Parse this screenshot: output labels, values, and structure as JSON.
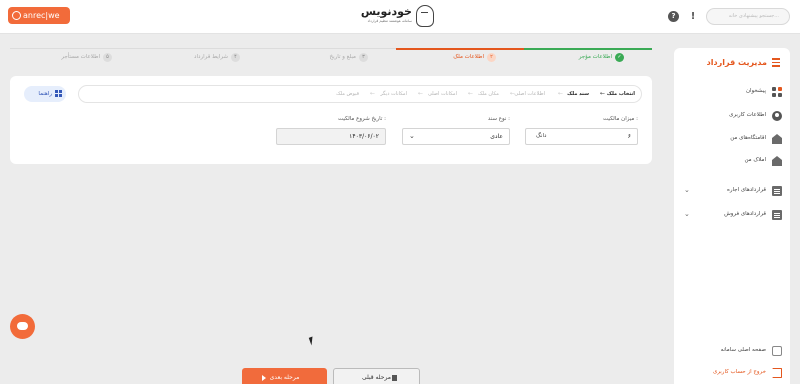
{
  "recorder": {
    "label": "anrec|we"
  },
  "header": {
    "brand": "خودنویس",
    "tagline": "سامانه هوشمند تنظیم قرارداد",
    "help_icon": "question-circle-icon",
    "alert_icon": "exclamation-icon",
    "search_placeholder": "جستجو پیشنهادی خانه..."
  },
  "sidebar": {
    "title": "مدیریت قرارداد",
    "items": [
      {
        "label": "پیشخوان",
        "icon": "dashboard-grid-icon"
      },
      {
        "label": "اطلاعات کاربری",
        "icon": "user-icon"
      },
      {
        "label": "اقامتگاه‌های من",
        "icon": "building-icon"
      },
      {
        "label": "املاک من",
        "icon": "house-icon"
      },
      {
        "label": "قراردادهای اجاره",
        "icon": "clipboard-icon"
      },
      {
        "label": "قراردادهای فروش",
        "icon": "clipboard-icon"
      }
    ],
    "footer": [
      {
        "label": "صفحه اصلی سامانه",
        "icon": "home-outline-icon"
      },
      {
        "label": "خروج از حساب کاربری",
        "icon": "logout-icon"
      }
    ]
  },
  "steps": [
    {
      "num": "✓",
      "label": "اطلاعات مؤجر",
      "state": "done"
    },
    {
      "num": "۲",
      "label": "اطلاعات ملک",
      "state": "active"
    },
    {
      "num": "۳",
      "label": "مبلغ و تاریخ",
      "state": "pending"
    },
    {
      "num": "۴",
      "label": "شرایط قرارداد",
      "state": "pending"
    },
    {
      "num": "۵",
      "label": "اطلاعات مستأجر",
      "state": "pending"
    }
  ],
  "panel": {
    "guide_label": "راهنما",
    "crumbs": [
      "انتخاب ملک",
      "سند ملک",
      "اطلاعات اصلی",
      "مکان ملک",
      "امکانات اصلی",
      "امکانات دیگر",
      "قبوض ملک"
    ],
    "fields": {
      "ownership_share": {
        "label": "میزان مالکیت :",
        "value": "۶",
        "unit": "دانگ"
      },
      "deed_type": {
        "label": "نوع سند :",
        "value": "عادی"
      },
      "ownership_date": {
        "label": "تاریخ شروع مالکیت :",
        "value": "۱۴۰۳/۰۶/۰۲"
      }
    }
  },
  "footer_buttons": {
    "next": "مرحله بعدی",
    "prev": "مرحله قبلی"
  },
  "colors": {
    "accent": "#e4571e",
    "success": "#3aaa55",
    "button": "#f16b3c"
  }
}
